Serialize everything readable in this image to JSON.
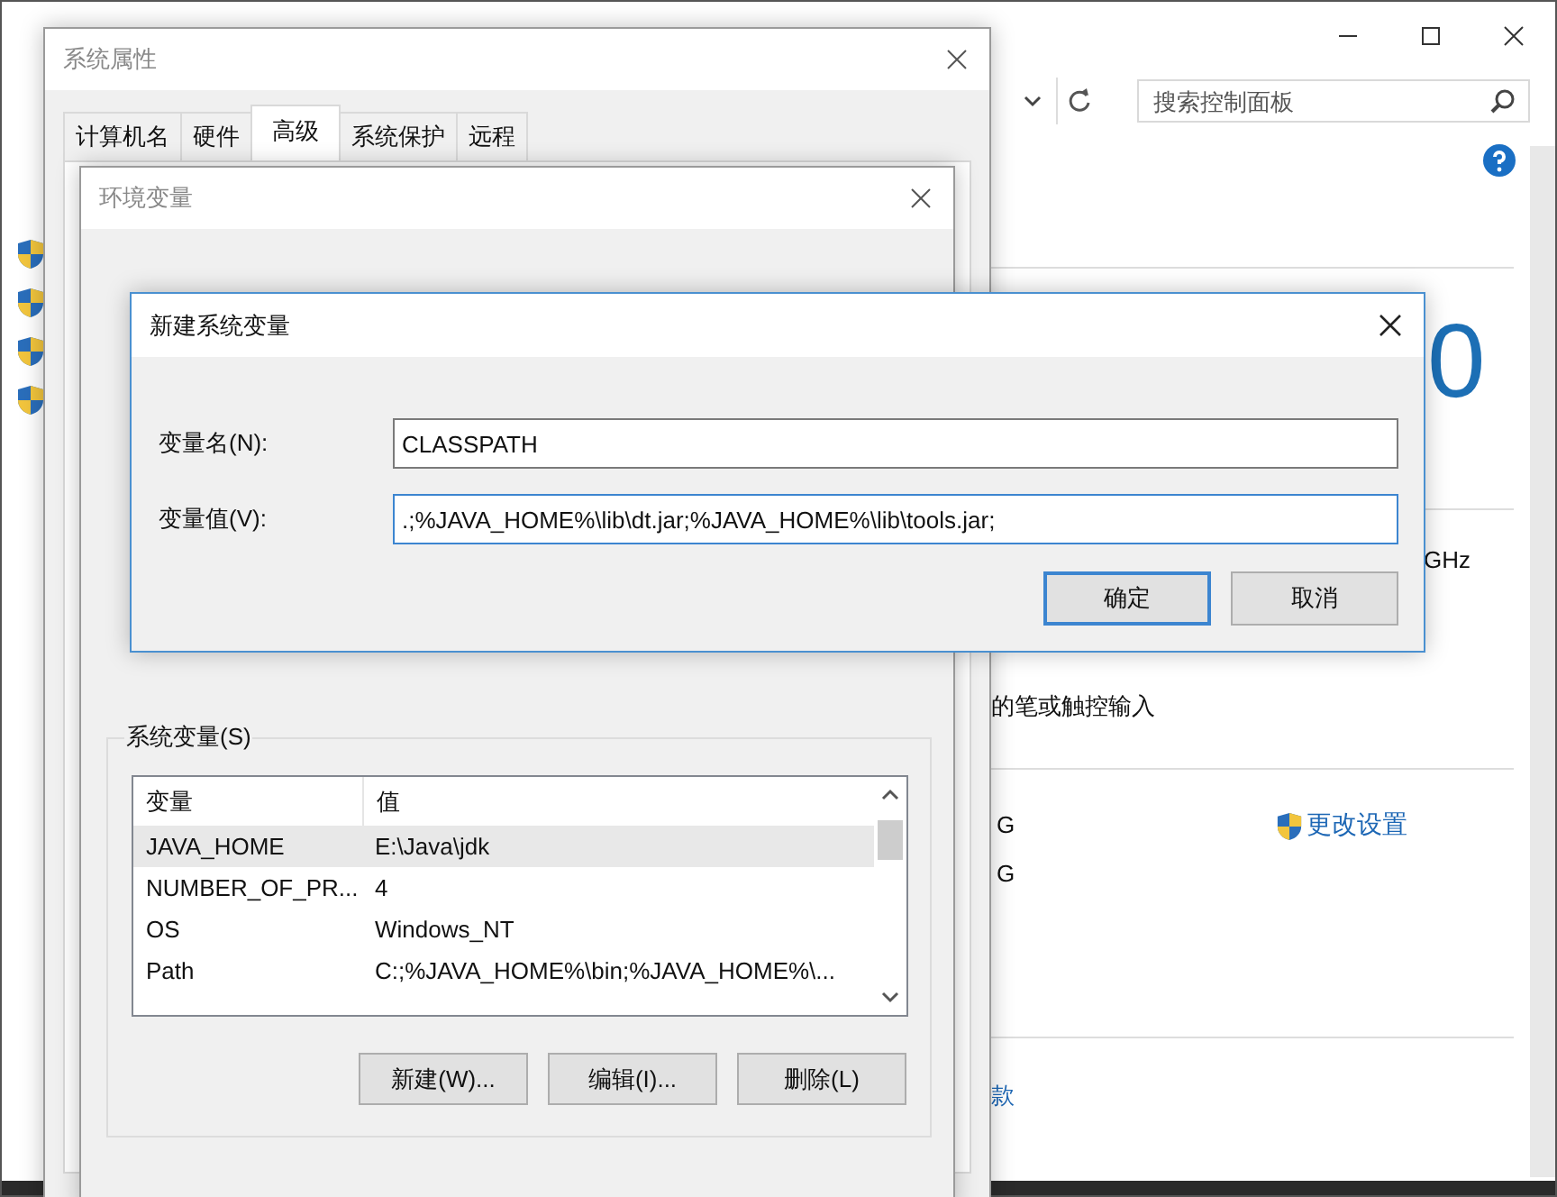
{
  "system_window": {
    "search": {
      "placeholder": "搜索控制面板"
    },
    "content": {
      "edition_digit": "0",
      "cpu_fragment": "GHz",
      "pen_fragment": "的笔或触控输入",
      "ram_fragments": [
        "G",
        "G"
      ],
      "change_settings": "更改设置",
      "link_fragment": "款"
    }
  },
  "system_properties": {
    "title": "系统属性",
    "tabs": [
      {
        "label": "计算机名",
        "selected": false
      },
      {
        "label": "硬件",
        "selected": false
      },
      {
        "label": "高级",
        "selected": true
      },
      {
        "label": "系统保护",
        "selected": false
      },
      {
        "label": "远程",
        "selected": false
      }
    ]
  },
  "environment_variables": {
    "title": "环境变量",
    "system_variables": {
      "label": "系统变量(S)",
      "columns": [
        "变量",
        "值"
      ],
      "rows": [
        {
          "name": "JAVA_HOME",
          "value": "E:\\Java\\jdk",
          "selected": true
        },
        {
          "name": "NUMBER_OF_PR...",
          "value": "4",
          "selected": false
        },
        {
          "name": "OS",
          "value": "Windows_NT",
          "selected": false
        },
        {
          "name": "Path",
          "value": "C:;%JAVA_HOME%\\bin;%JAVA_HOME%\\...",
          "selected": false
        }
      ],
      "buttons": [
        "新建(W)...",
        "编辑(I)...",
        "删除(L)"
      ]
    }
  },
  "new_variable": {
    "title": "新建系统变量",
    "fields": [
      {
        "label": "变量名(N):",
        "value": "CLASSPATH",
        "focused": false
      },
      {
        "label": "变量值(V):",
        "value": ".;%JAVA_HOME%\\lib\\dt.jar;%JAVA_HOME%\\lib\\tools.jar;",
        "focused": true
      }
    ],
    "buttons": [
      {
        "label": "确定",
        "default": true
      },
      {
        "label": "取消",
        "default": false
      }
    ]
  }
}
